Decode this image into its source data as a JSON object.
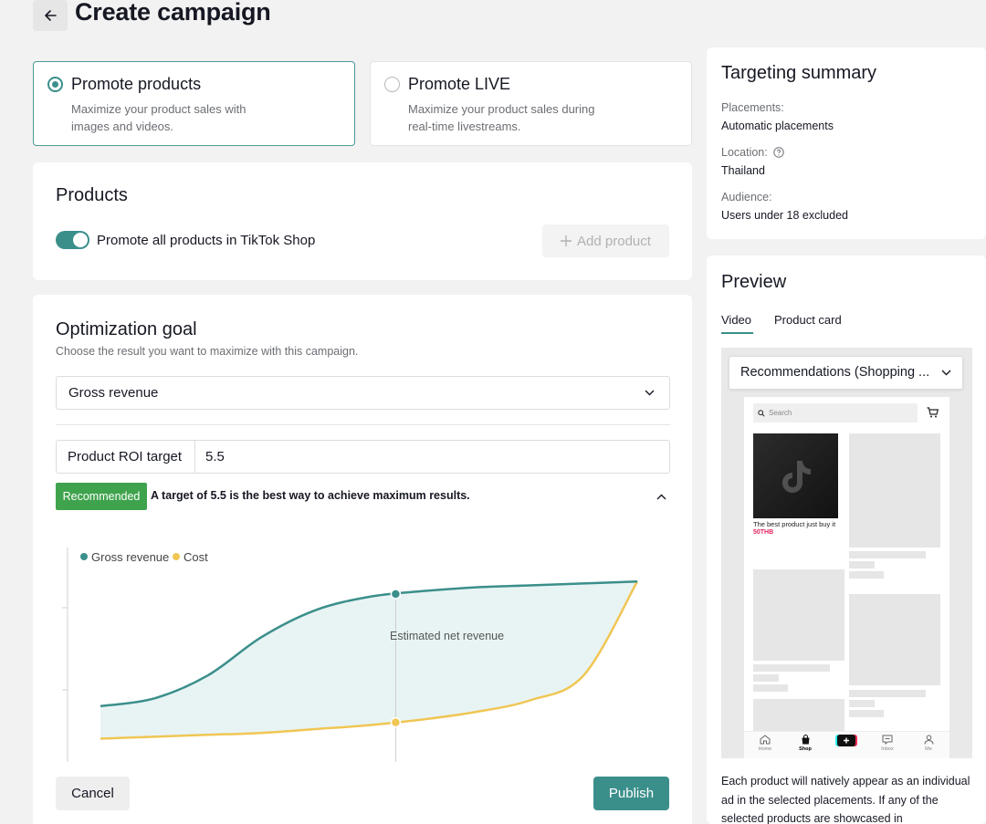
{
  "header": {
    "title": "Create campaign",
    "back_icon": "arrow-left-icon"
  },
  "promote_options": [
    {
      "title": "Promote products",
      "description": "Maximize your product sales with images and videos.",
      "selected": true
    },
    {
      "title": "Promote LIVE",
      "description": "Maximize your product sales during real-time livestreams.",
      "selected": false
    }
  ],
  "products": {
    "title": "Products",
    "toggle_label": "Promote all products in TikTok Shop",
    "toggle_on": true,
    "add_button": "Add product"
  },
  "optimization": {
    "title": "Optimization goal",
    "subtitle": "Choose the result you want to maximize with this campaign.",
    "goal_value": "Gross revenue",
    "roi_label": "Product ROI target",
    "roi_value": "5.5",
    "badge": "Recommended",
    "recommendation": "A target of 5.5 is the best way to achieve maximum results."
  },
  "chart_data": {
    "type": "area",
    "legend": [
      "Gross revenue",
      "Cost"
    ],
    "annotation": "Estimated net revenue",
    "colors": {
      "gross_revenue": "#3b8f8b",
      "cost": "#f0c654",
      "fill": "#e8f4f4"
    },
    "x": [
      0,
      10,
      20,
      30,
      40,
      50,
      60,
      70,
      80,
      90,
      100
    ],
    "series": [
      {
        "name": "Gross revenue",
        "values": [
          22,
          26,
          38,
          58,
          72,
          79,
          82,
          84,
          85,
          86,
          87
        ]
      },
      {
        "name": "Cost",
        "values": [
          5,
          6,
          7,
          8,
          10,
          12,
          15,
          19,
          25,
          38,
          87
        ]
      }
    ],
    "marker_x": 55
  },
  "footer": {
    "cancel": "Cancel",
    "publish": "Publish"
  },
  "targeting_summary": {
    "title": "Targeting summary",
    "items": [
      {
        "label": "Placements:",
        "value": "Automatic placements",
        "help": false
      },
      {
        "label": "Location:",
        "value": "Thailand",
        "help": true
      },
      {
        "label": "Audience:",
        "value": "Users under 18 excluded",
        "help": false
      }
    ]
  },
  "preview": {
    "title": "Preview",
    "tabs": [
      {
        "label": "Video",
        "active": true
      },
      {
        "label": "Product card",
        "active": false
      }
    ],
    "placement": "Recommendations (Shopping ...",
    "phone": {
      "search_placeholder": "Search",
      "product_caption": "The best product just buy it",
      "product_price": "50THB",
      "nav": [
        "Home",
        "Shop",
        "",
        "Inbox",
        "Me"
      ]
    },
    "footer_text": "Each product will natively appear as an individual ad in the selected placements. If any of the selected products are showcased in"
  }
}
